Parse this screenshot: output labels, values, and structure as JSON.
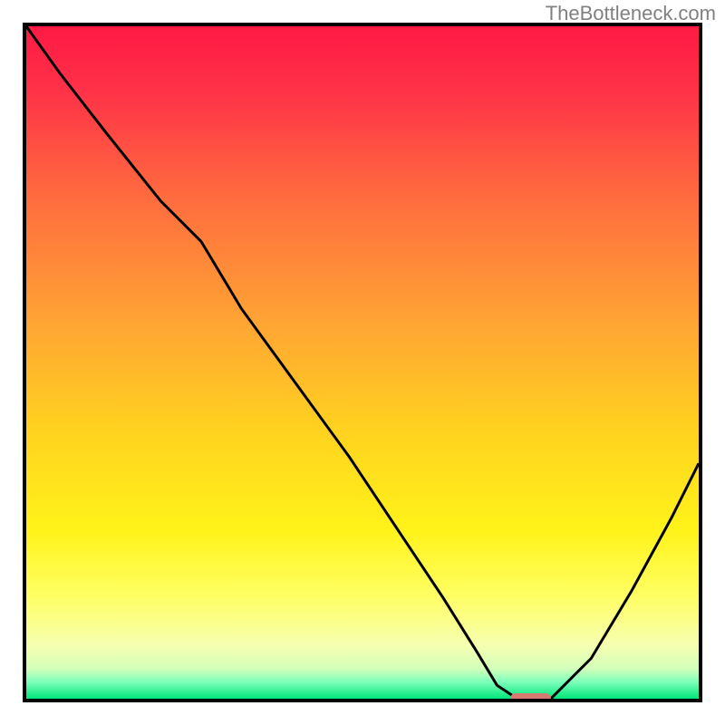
{
  "watermark": "TheBottleneck.com",
  "colors": {
    "gradient_stops": [
      {
        "offset": 0.0,
        "color": "#ff1a44"
      },
      {
        "offset": 0.1,
        "color": "#ff3348"
      },
      {
        "offset": 0.25,
        "color": "#ff6a3f"
      },
      {
        "offset": 0.45,
        "color": "#ffa733"
      },
      {
        "offset": 0.6,
        "color": "#ffd21f"
      },
      {
        "offset": 0.75,
        "color": "#fff31a"
      },
      {
        "offset": 0.85,
        "color": "#ffff66"
      },
      {
        "offset": 0.92,
        "color": "#f6ffb0"
      },
      {
        "offset": 0.955,
        "color": "#d4ffba"
      },
      {
        "offset": 0.975,
        "color": "#7dffba"
      },
      {
        "offset": 1.0,
        "color": "#00e57a"
      }
    ],
    "curve": "#000000",
    "marker": "#d77a72",
    "border": "#000000"
  },
  "chart_data": {
    "type": "line",
    "title": "",
    "xlabel": "",
    "ylabel": "",
    "xlim": [
      0,
      100
    ],
    "ylim": [
      0,
      100
    ],
    "series": [
      {
        "name": "bottleneck-curve",
        "x": [
          0,
          5,
          12,
          20,
          26,
          32,
          40,
          48,
          56,
          62,
          67,
          70,
          73,
          78,
          84,
          90,
          96,
          100
        ],
        "y": [
          100,
          93,
          84,
          74,
          68,
          58,
          47,
          36,
          24,
          15,
          7,
          2,
          0,
          0,
          6,
          16,
          27,
          35
        ]
      }
    ],
    "marker": {
      "x": 75,
      "y": 0,
      "width": 6
    }
  }
}
